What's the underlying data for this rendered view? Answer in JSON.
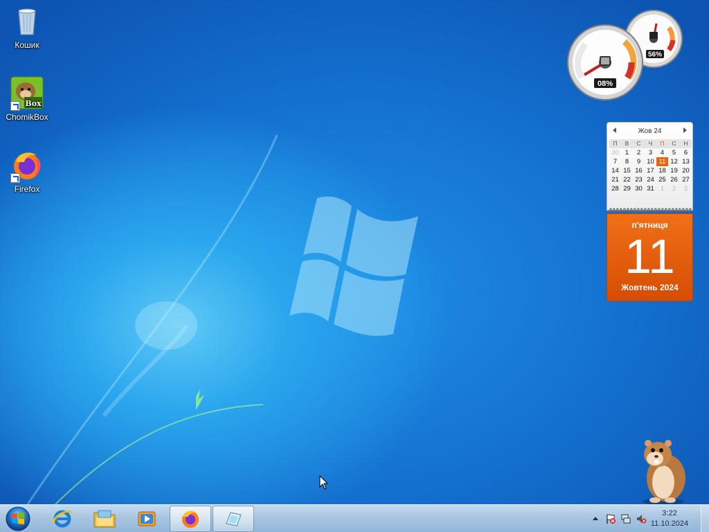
{
  "desktop": {
    "icons": [
      {
        "label": "Кошик",
        "icon": "recycle-bin-icon"
      },
      {
        "label": "ChomikBox",
        "icon": "chomikbox-icon"
      },
      {
        "label": "Firefox",
        "icon": "firefox-icon"
      }
    ]
  },
  "gadgets": {
    "cpu_meter": {
      "cpu_percent_label": "08%",
      "cpu_percent": 8,
      "memory_percent_label": "56%",
      "memory_percent": 56
    },
    "calendar": {
      "month_header": "Жов 24",
      "weekdays": [
        "П",
        "В",
        "С",
        "Ч",
        "П",
        "С",
        "Н"
      ],
      "highlight_weekday_index": 4,
      "weeks": [
        [
          "30",
          "1",
          "2",
          "3",
          "4",
          "5",
          "6"
        ],
        [
          "7",
          "8",
          "9",
          "10",
          "11",
          "12",
          "13"
        ],
        [
          "14",
          "15",
          "16",
          "17",
          "18",
          "19",
          "20"
        ],
        [
          "21",
          "22",
          "23",
          "24",
          "25",
          "26",
          "27"
        ],
        [
          "28",
          "29",
          "30",
          "31",
          "1",
          "2",
          "3"
        ]
      ],
      "today": "11",
      "day_of_week": "п'ятниця",
      "big_day": "11",
      "month_year": "Жовтень 2024"
    }
  },
  "taskbar": {
    "start": "windows-start-icon",
    "pinned": [
      {
        "name": "internet-explorer",
        "icon": "ie-icon",
        "active": false
      },
      {
        "name": "windows-explorer",
        "icon": "folder-icon",
        "active": false
      },
      {
        "name": "media-player",
        "icon": "media-player-icon",
        "active": false
      },
      {
        "name": "firefox",
        "icon": "firefox-icon",
        "active": true
      },
      {
        "name": "notepad-app",
        "icon": "notepad-icon",
        "active": true
      }
    ],
    "tray": {
      "icons": [
        "show-hidden-icons-arrow",
        "action-center-flag-icon",
        "network-icon",
        "volume-muted-icon"
      ],
      "time": "3:22",
      "date": "11.10.2024"
    }
  },
  "colors": {
    "desktop_blue": "#1470cf",
    "calendar_orange": "#e8640f",
    "taskbar": "#a9c6e2"
  }
}
